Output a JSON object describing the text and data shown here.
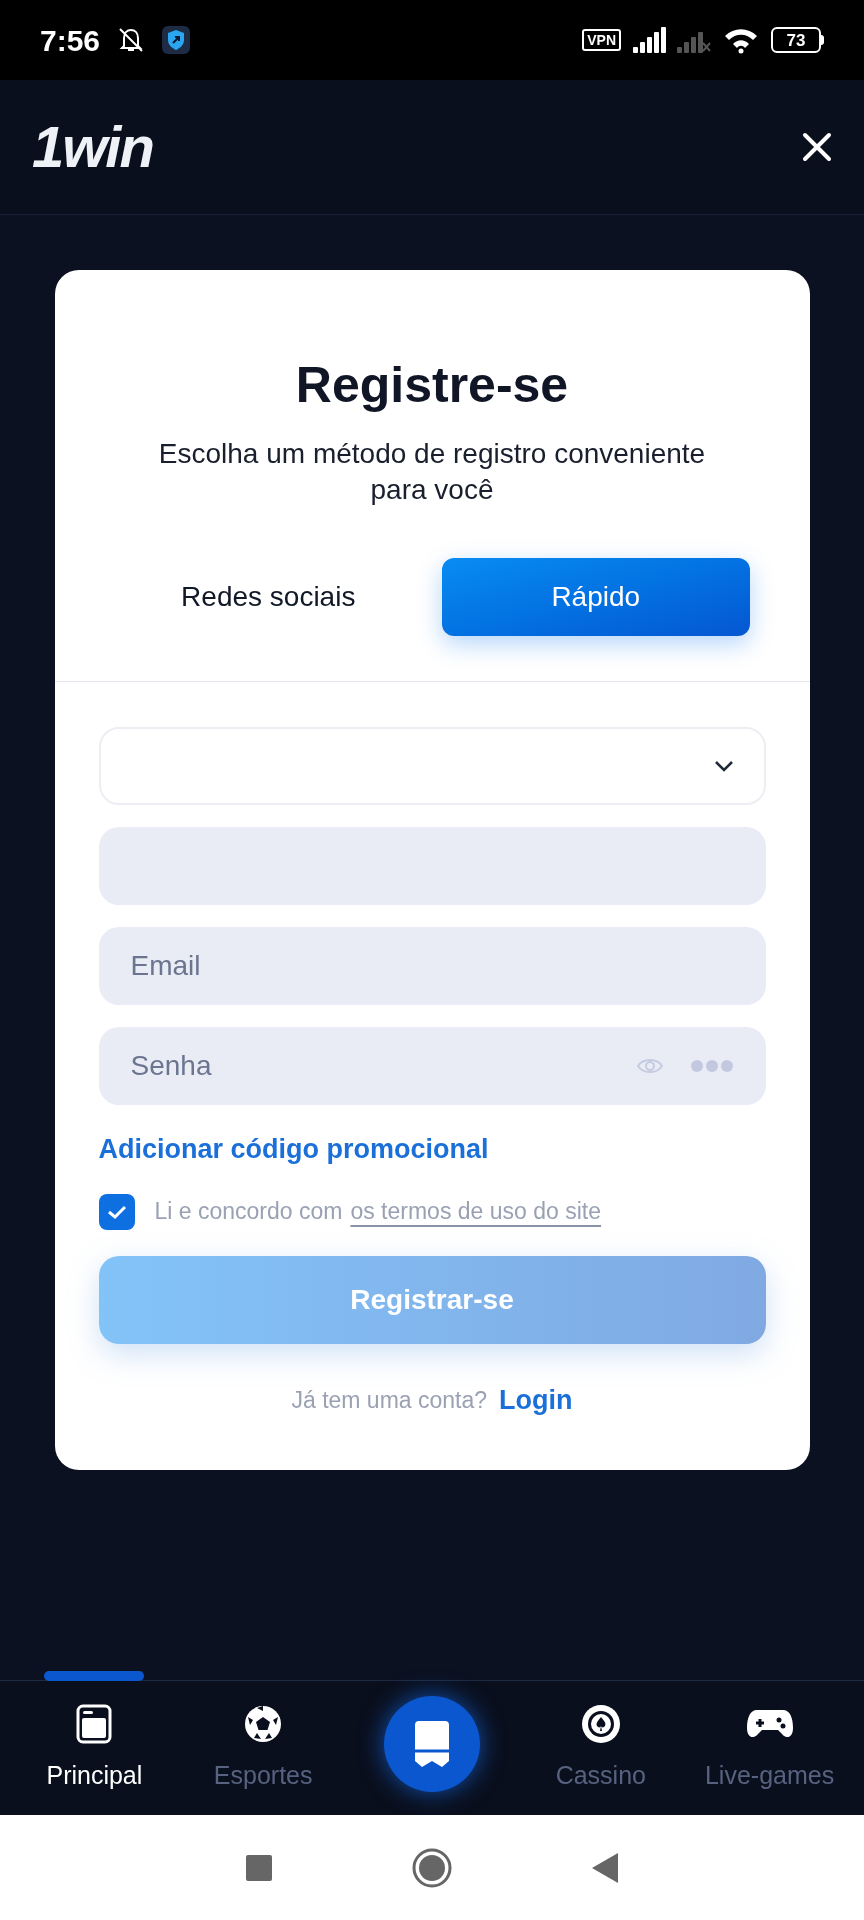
{
  "status_bar": {
    "time": "7:56",
    "vpn": "VPN",
    "battery": "73"
  },
  "header": {
    "logo": "1win"
  },
  "dialog": {
    "title": "Registre-se",
    "subtitle": "Escolha um método de registro conveniente para você",
    "tabs": [
      {
        "label": "Redes sociais",
        "selected": false
      },
      {
        "label": "Rápido",
        "selected": true
      }
    ],
    "fields": [
      {
        "kind": "select"
      },
      {
        "kind": "text"
      },
      {
        "kind": "text",
        "placeholder": "Email"
      },
      {
        "kind": "password",
        "placeholder": "Senha"
      }
    ],
    "promo_link": "Adicionar código promocional",
    "terms": {
      "checked": true,
      "text": "Li e concordo com",
      "link": "os termos de uso do site"
    },
    "submit": "Registrar-se",
    "login_prompt": "Já tem uma conta?",
    "login_link": "Login"
  },
  "bottom_nav": [
    {
      "kind": "home",
      "label": "Principal",
      "selected": true
    },
    {
      "kind": "sports",
      "label": "Esportes",
      "selected": false
    },
    {
      "kind": "bets",
      "selected": false
    },
    {
      "kind": "casino",
      "label": "Cassino",
      "selected": false
    },
    {
      "kind": "games",
      "label": "Live-games",
      "selected": false
    }
  ]
}
